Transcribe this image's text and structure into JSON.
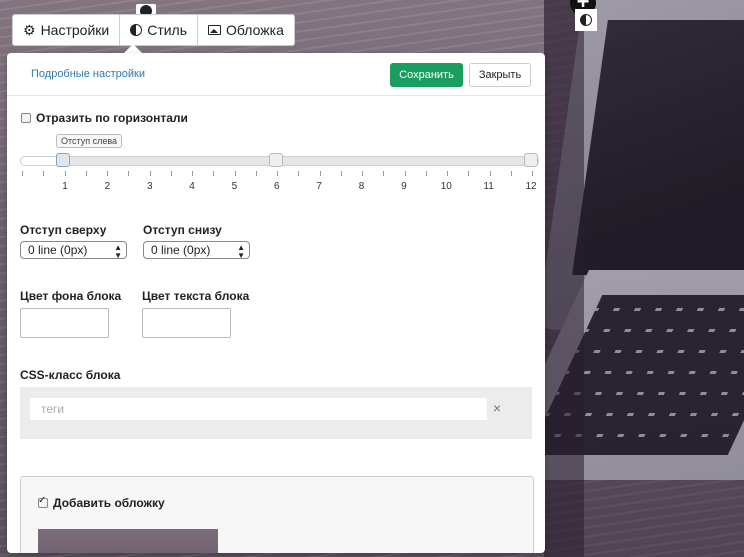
{
  "tabs": [
    {
      "label": "Настройки",
      "icon": "gear-icon"
    },
    {
      "label": "Стиль",
      "icon": "contrast-icon"
    },
    {
      "label": "Обложка",
      "icon": "image-icon"
    }
  ],
  "header": {
    "advanced_link": "Подробные настройки",
    "save_label": "Сохранить",
    "close_label": "Закрыть"
  },
  "flip": {
    "label": "Отразить по горизонтали",
    "checked": false
  },
  "slider": {
    "tooltip": "Отступ слева",
    "ticks": [
      "1",
      "2",
      "3",
      "4",
      "5",
      "6",
      "7",
      "8",
      "9",
      "10",
      "11",
      "12"
    ],
    "values": [
      1,
      6,
      12
    ]
  },
  "padding": {
    "top_label": "Отступ сверху",
    "top_value": "0 line (0px)",
    "bottom_label": "Отступ снизу",
    "bottom_value": "0 line (0px)"
  },
  "colors": {
    "bg_label": "Цвет фона блока",
    "text_label": "Цвет текста блока",
    "accent": "#1a9e5f",
    "link": "#2a7ab5"
  },
  "css_class": {
    "label": "CSS-класс блока",
    "placeholder": "теги",
    "clear_icon": "×"
  },
  "cover": {
    "label": "Добавить обложку",
    "checked": true
  }
}
